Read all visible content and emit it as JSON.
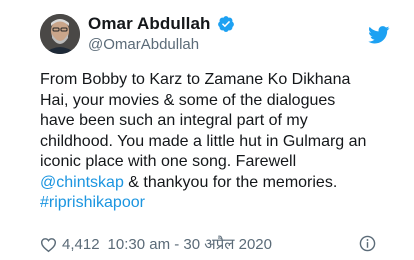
{
  "tweet": {
    "author": {
      "display_name": "Omar Abdullah",
      "handle": "@OmarAbdullah",
      "verified": true
    },
    "text_lines": [
      [
        {
          "t": "From Bobby to Karz to Zamane Ko Dikhana",
          "link": false
        }
      ],
      [
        {
          "t": "Hai, your movies & some of the dialogues",
          "link": false
        }
      ],
      [
        {
          "t": "have been such an integral part of my",
          "link": false
        }
      ],
      [
        {
          "t": "childhood. You made a little hut in Gulmarg an",
          "link": false
        }
      ],
      [
        {
          "t": "iconic place with one song. Farewell",
          "link": false
        }
      ],
      [
        {
          "t": "@chintskap",
          "link": true
        },
        {
          "t": " & thankyou for the memories.",
          "link": false
        }
      ],
      [
        {
          "t": "#riprishikapoor",
          "link": true
        }
      ]
    ],
    "likes": "4,412",
    "timestamp": "10:30 am - 30 अप्रैल 2020"
  },
  "icons": {
    "platform_logo": "twitter-bird-icon",
    "verified": "verified-badge-icon",
    "like": "heart-icon",
    "info": "info-icon"
  },
  "colors": {
    "brand_blue": "#1da1f2",
    "link_blue": "#1b95e0",
    "text": "#14171a",
    "secondary_text": "#5b6b78"
  }
}
